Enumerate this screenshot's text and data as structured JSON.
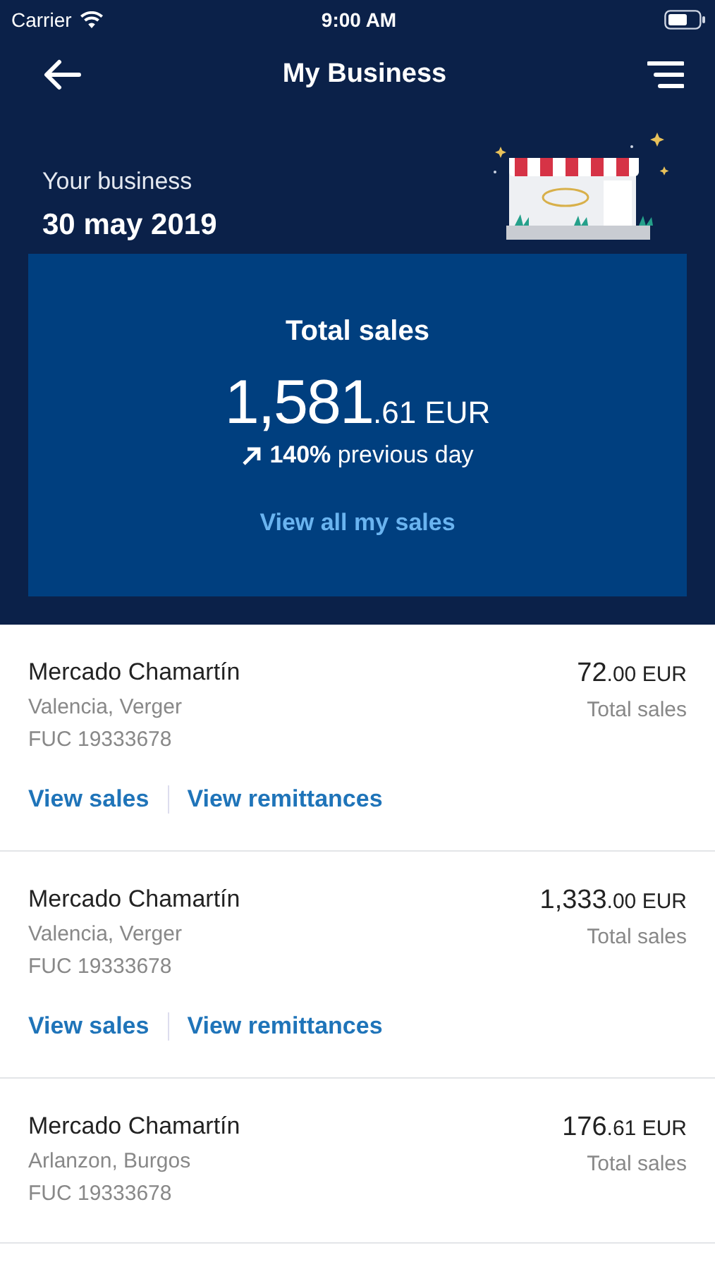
{
  "status_bar": {
    "carrier": "Carrier",
    "time": "9:00 AM"
  },
  "nav": {
    "title": "My Business"
  },
  "header": {
    "label": "Your business",
    "date": "30 may 2019"
  },
  "summary": {
    "title": "Total sales",
    "amount": {
      "whole": "1,581",
      "fraction": ".61 EUR"
    },
    "change": "**140%** previous day",
    "link": "View all my sales"
  },
  "stores": [
    {
      "name": "Mercado Chamartín",
      "location": "Valencia, Verger",
      "code": "FUC 19333678",
      "amount": {
        "whole": "72",
        "fraction": ".00 EUR"
      },
      "amount_label": "Total sales",
      "actions": [
        "View sales",
        "View remittances"
      ]
    },
    {
      "name": "Mercado Chamartín",
      "location": "Valencia, Verger",
      "code": "FUC 19333678",
      "amount": {
        "whole": "1,333",
        "fraction": ".00 EUR"
      },
      "amount_label": "Total sales",
      "actions": [
        "View sales",
        "View remittances"
      ]
    },
    {
      "name": "Mercado Chamartín",
      "location": "Arlanzon, Burgos",
      "code": "FUC 19333678",
      "amount": {
        "whole": "176",
        "fraction": ".61 EUR"
      },
      "amount_label": "Total sales"
    }
  ]
}
